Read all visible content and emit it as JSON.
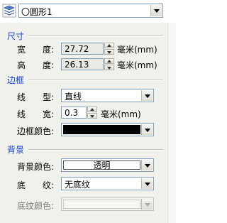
{
  "object_selector": {
    "value": "〇圆形1"
  },
  "size": {
    "title": "尺寸",
    "width_label": "宽　　度:",
    "width_value": "27.72",
    "height_label": "高　　度:",
    "height_value": "26.13",
    "unit": "毫米(mm)"
  },
  "border": {
    "title": "边框",
    "line_type_label": "线　　型:",
    "line_type_value": "直线",
    "line_width_label": "线　　宽:",
    "line_width_value": "0.3",
    "line_width_unit": "毫米(mm)",
    "color_label": "边框颜色:",
    "color_value": "#000000"
  },
  "background": {
    "title": "背景",
    "color_label": "背景颜色:",
    "color_value": "透明",
    "pattern_label": "底　　纹:",
    "pattern_value": "无底纹",
    "pattern_color_label": "底纹颜色:"
  }
}
